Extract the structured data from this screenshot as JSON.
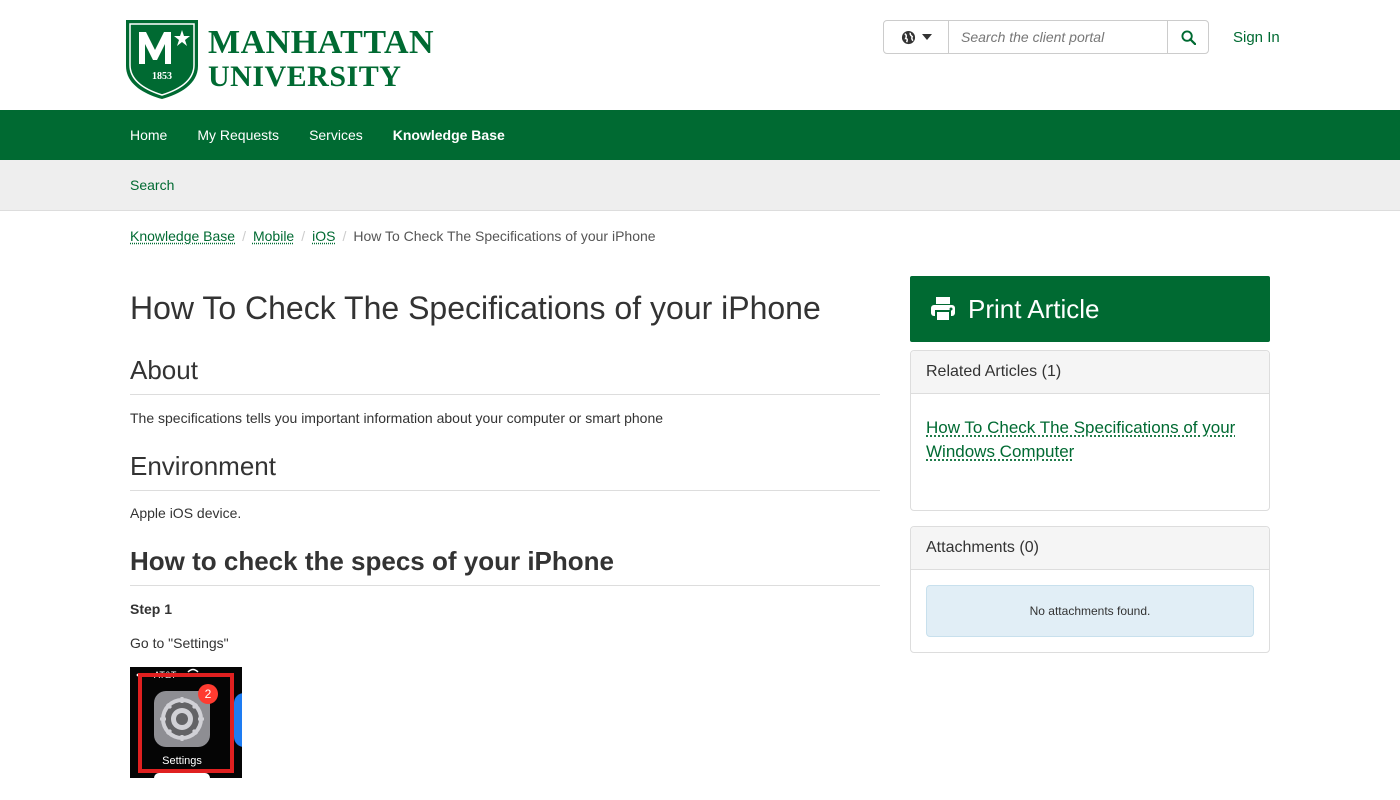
{
  "brand": {
    "shield_letter": "M",
    "shield_year": "1853",
    "name_line1": "MANHATTAN",
    "name_line2": "UNIVERSITY",
    "color": "#006a32"
  },
  "header": {
    "language_icon": "globe-icon",
    "search_placeholder": "Search the client portal",
    "search_value": "",
    "search_icon": "search-icon",
    "sign_in_label": "Sign In"
  },
  "nav": {
    "items": [
      {
        "label": "Home",
        "active": false
      },
      {
        "label": "My Requests",
        "active": false
      },
      {
        "label": "Services",
        "active": false
      },
      {
        "label": "Knowledge Base",
        "active": true
      }
    ]
  },
  "subnav": {
    "search_label": "Search"
  },
  "breadcrumb": {
    "items": [
      "Knowledge Base",
      "Mobile",
      "iOS"
    ],
    "current": "How To Check The Specifications of your iPhone"
  },
  "article": {
    "title": "How To Check The Specifications of your iPhone",
    "about_heading": "About",
    "about_text": "The specifications tells you important information about your computer or smart phone",
    "environment_heading": "Environment",
    "environment_text": "Apple iOS device.",
    "howto_heading": "How to check the specs of your iPhone",
    "step_label": "Step 1",
    "step_text": "Go to \"Settings\"",
    "screenshot": {
      "carrier": "AT&T",
      "badge": "2",
      "app_label": "Settings",
      "highlight_color": "#e02020"
    }
  },
  "sidebar": {
    "print_label": "Print Article",
    "print_icon": "printer-icon",
    "related_heading": "Related Articles (1)",
    "related_items": [
      "How To Check The Specifications of your Windows Computer"
    ],
    "attachments_heading": "Attachments (0)",
    "attachments_empty": "No attachments found."
  }
}
